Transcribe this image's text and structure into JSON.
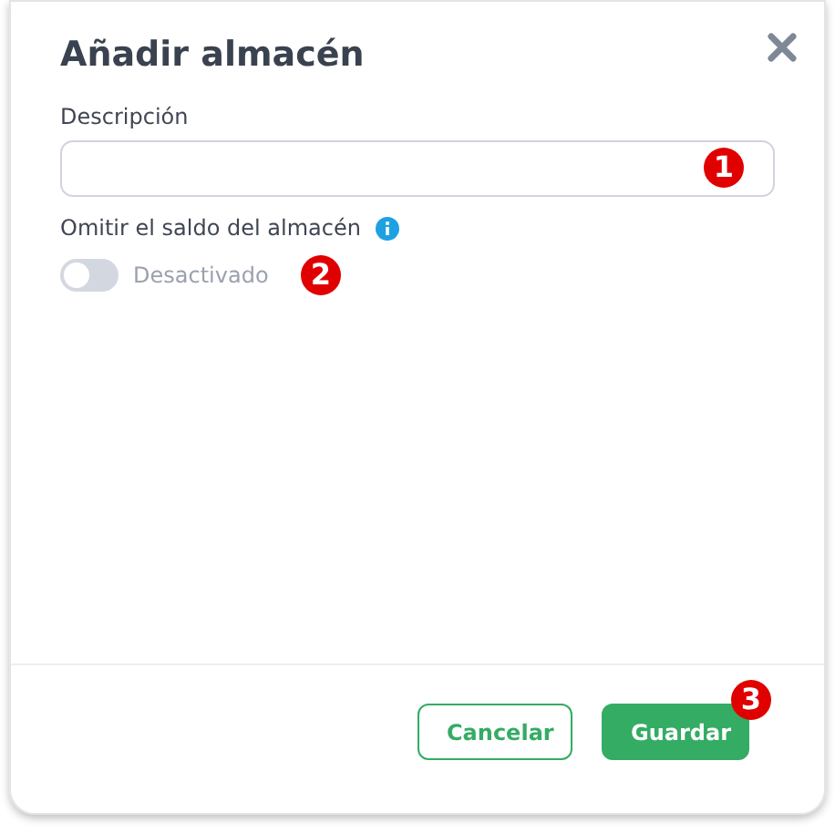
{
  "dialog": {
    "title": "Añadir almacén"
  },
  "description_field": {
    "label": "Descripción",
    "callout": "1"
  },
  "omit_balance": {
    "label": "Omitir el saldo del almacén",
    "on": false,
    "state_label": "Desactivado",
    "callout": "2"
  },
  "buttons": [
    {
      "label": "Cancelar",
      "kind": "secondary"
    },
    {
      "label": "Guardar",
      "kind": "primary",
      "callout": "3"
    }
  ]
}
